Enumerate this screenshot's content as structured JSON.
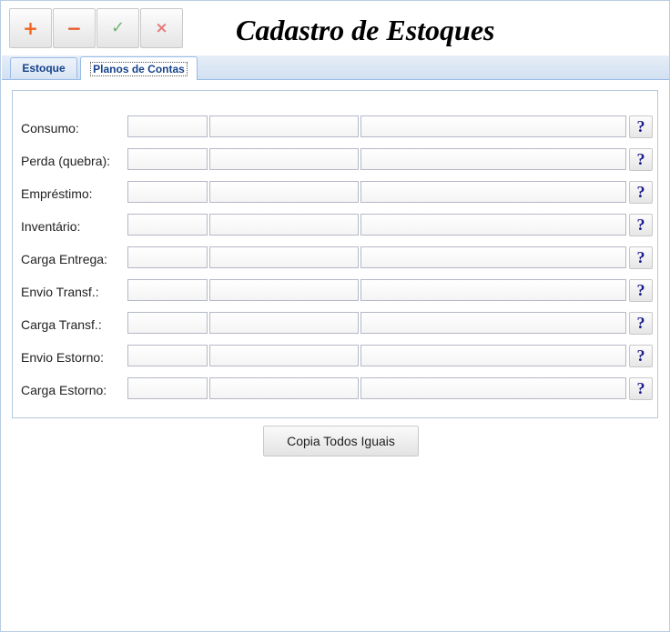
{
  "toolbar": {
    "add_icon": "plus-icon",
    "remove_icon": "minus-icon",
    "confirm_icon": "check-icon",
    "cancel_icon": "close-icon",
    "add_glyph": "+",
    "remove_glyph": "−",
    "confirm_glyph": "✓",
    "cancel_glyph": "×"
  },
  "title": "Cadastro de Estoques",
  "tabs": [
    {
      "label": "Estoque"
    },
    {
      "label": "Planos de Contas",
      "active": true
    }
  ],
  "rows": [
    {
      "label": "Consumo:",
      "code": "",
      "account": "",
      "description": ""
    },
    {
      "label": "Perda (quebra):",
      "code": "",
      "account": "",
      "description": ""
    },
    {
      "label": "Empréstimo:",
      "code": "",
      "account": "",
      "description": ""
    },
    {
      "label": "Inventário:",
      "code": "",
      "account": "",
      "description": ""
    },
    {
      "label": "Carga Entrega:",
      "code": "",
      "account": "",
      "description": ""
    },
    {
      "label": "Envio Transf.:",
      "code": "",
      "account": "",
      "description": ""
    },
    {
      "label": "Carga Transf.:",
      "code": "",
      "account": "",
      "description": ""
    },
    {
      "label": "Envio Estorno:",
      "code": "",
      "account": "",
      "description": ""
    },
    {
      "label": "Carga Estorno:",
      "code": "",
      "account": "",
      "description": ""
    }
  ],
  "lookup_glyph": "?",
  "copy_button": "Copia Todos Iguais",
  "colors": {
    "tab_text": "#15428b",
    "border": "#99bbe8",
    "add": "#f0641e",
    "confirm": "#6fb46f",
    "cancel": "#e57b7b",
    "lookup": "#1a1a8c"
  }
}
